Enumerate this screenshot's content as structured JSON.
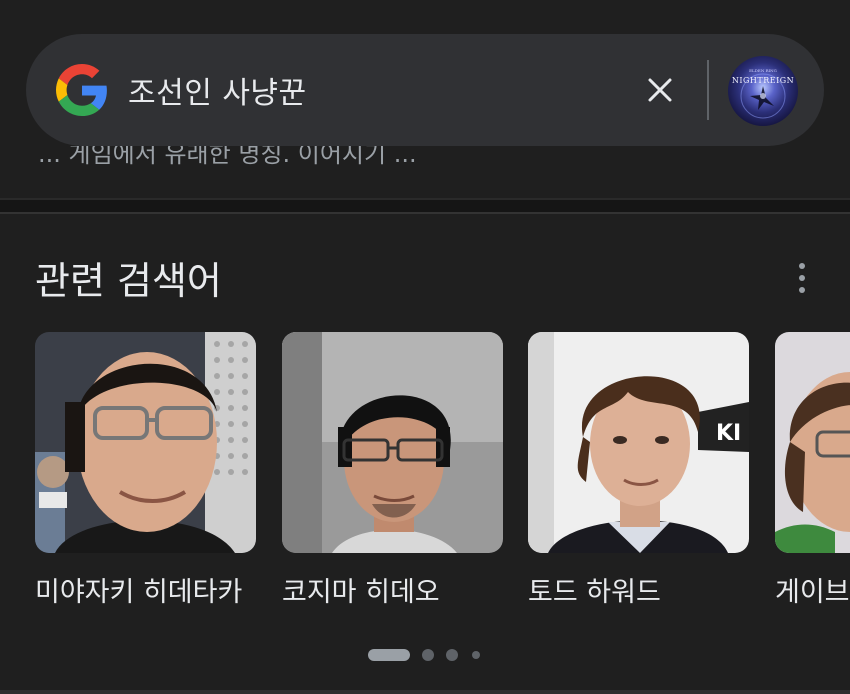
{
  "search": {
    "query": "조선인 사냥꾼",
    "avatar_title": "NIGHTREIGN",
    "avatar_subtitle": "ELDEN RING"
  },
  "snippet": {
    "text": "... 게임에서 유래한 명칭. 이어지기 ..."
  },
  "related": {
    "title": "관련 검색어",
    "items": [
      {
        "label": "미야자키 히데타카"
      },
      {
        "label": "코지마 히데오"
      },
      {
        "label": "토드 하워드"
      },
      {
        "label": "게이브"
      }
    ]
  },
  "carousel": {
    "pages": 4,
    "active": 1
  },
  "colors": {
    "background": "#1f1f1f",
    "search_bar": "#303134",
    "text_primary": "#e8eaed",
    "text_secondary": "#9aa0a6",
    "google_blue": "#4285F4",
    "google_red": "#EA4335",
    "google_yellow": "#FBBC05",
    "google_green": "#34A853"
  }
}
